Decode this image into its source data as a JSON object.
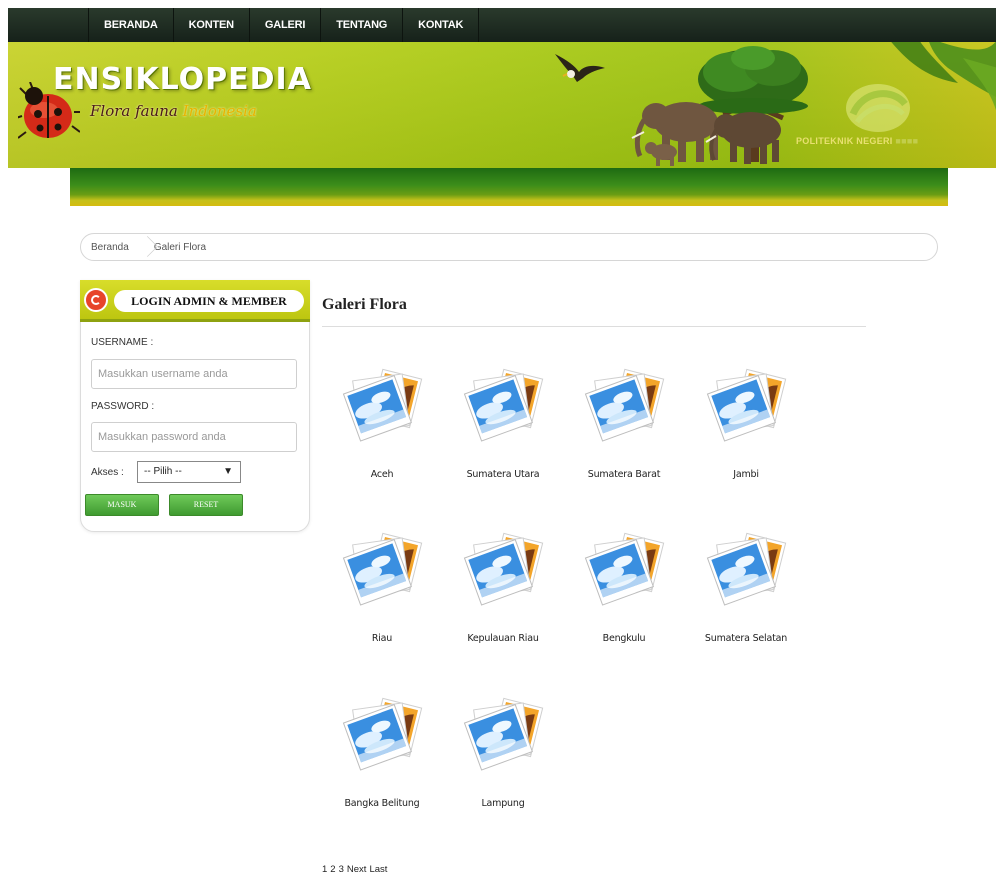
{
  "nav": {
    "items": [
      "BERANDA",
      "KONTEN",
      "GALERI",
      "TENTANG",
      "KONTAK"
    ]
  },
  "banner": {
    "title": "ENSIKLOPEDIA",
    "subtitle_part1": "Flora fauna ",
    "subtitle_part2": "Indonesia",
    "institution": "POLITEKNIK NEGERI"
  },
  "breadcrumb": {
    "home": "Beranda",
    "current": "Galeri Flora"
  },
  "login": {
    "heading": "LOGIN ADMIN & MEMBER",
    "username_label": "USERNAME :",
    "username_placeholder": "Masukkan username anda",
    "password_label": "PASSWORD :",
    "password_placeholder": "Masukkan password anda",
    "akses_label": "Akses :",
    "akses_selected": "-- Pilih --",
    "submit_label": "MASUK",
    "reset_label": "RESET"
  },
  "main": {
    "title": "Galeri Flora",
    "items": [
      {
        "label": "Aceh"
      },
      {
        "label": "Sumatera Utara"
      },
      {
        "label": "Sumatera Barat"
      },
      {
        "label": "Jambi"
      },
      {
        "label": "Riau"
      },
      {
        "label": "Kepulauan Riau"
      },
      {
        "label": "Bengkulu"
      },
      {
        "label": "Sumatera Selatan"
      },
      {
        "label": "Bangka Belitung"
      },
      {
        "label": "Lampung"
      }
    ]
  },
  "pager": {
    "pages": [
      "1",
      "2",
      "3"
    ],
    "next": "Next",
    "last": "Last"
  },
  "colors": {
    "banner": "#b8cf1c",
    "nav": "#1f2d22",
    "button": "#4fae3c"
  }
}
